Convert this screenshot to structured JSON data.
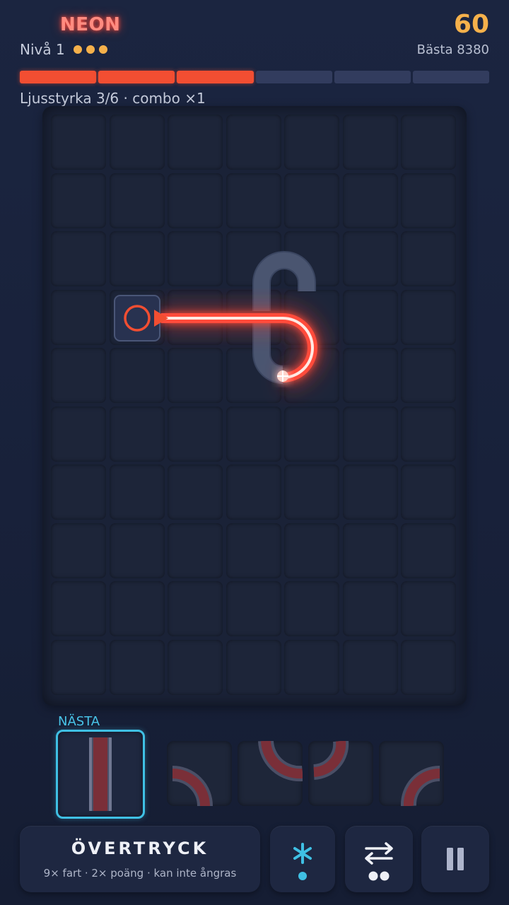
{
  "header": {
    "title": "NEON",
    "level_label": "Nivå 1",
    "level_stars": 3,
    "score": "60",
    "best": "Bästa 8380"
  },
  "progress": {
    "filled": 3,
    "total": 6
  },
  "status": "Ljusstyrka  3/6 · combo ×1",
  "next": {
    "label": "NÄSTA"
  },
  "queue": [
    "straight-vertical",
    "curve",
    "curve",
    "curve",
    "curve"
  ],
  "buttons": {
    "overdrive_title": "ÖVERTRYCK",
    "overdrive_sub": "9× fart · 2× poäng · kan inte ångras",
    "freeze_icon": "snowflake-icon",
    "swap_icon": "swap-arrows-icon",
    "pause_icon": "pause-icon"
  },
  "colors": {
    "accent": "#f24e32",
    "laser": "#ff5a4a",
    "score": "#f5b14b",
    "next_border": "#3fc0e4"
  }
}
